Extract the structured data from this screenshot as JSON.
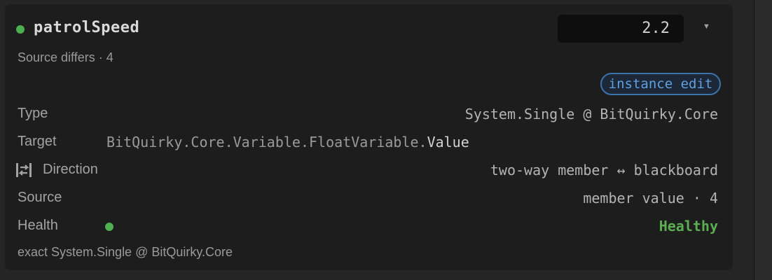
{
  "header": {
    "title": "patrolSpeed",
    "status_color": "#4caf50"
  },
  "source_status": "Source differs · 4",
  "value_field": {
    "value": "2.2",
    "dropdown_icon": "chevron-down-icon"
  },
  "badge": "instance edit",
  "rows": {
    "type": {
      "label": "Type",
      "value": "System.Single @ BitQuirky.Core"
    },
    "target": {
      "label": "Target",
      "prefix": "BitQuirky.Core.Variable.FloatVariable.",
      "member": "Value"
    },
    "direction": {
      "label": "Direction",
      "value": "two-way member ↔ blackboard",
      "icon": "two-way-arrows-icon"
    },
    "source": {
      "label": "Source",
      "value": "member value · 4"
    },
    "health": {
      "label": "Health",
      "value": "Healthy",
      "color": "#5cae52"
    }
  },
  "footer": "exact System.Single @ BitQuirky.Core"
}
